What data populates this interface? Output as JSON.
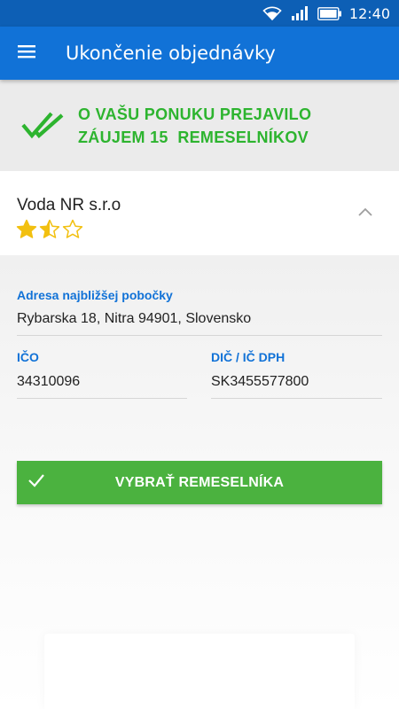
{
  "status_bar": {
    "time": "12:40",
    "icons": [
      "wifi-icon",
      "signal-icon",
      "battery-icon"
    ]
  },
  "app_bar": {
    "menu_icon": "hamburger-menu-icon",
    "title": "Ukončenie objednávky"
  },
  "banner": {
    "icon": "double-check-icon",
    "line1": "O VAŠU PONUKU PREJAVILO",
    "line2": "ZÁUJEM 15  REMESELNÍKOV"
  },
  "craftsman": {
    "name": "Voda NR s.r.o",
    "rating": 1.5,
    "rating_max": 3,
    "expand_icon": "chevron-up-icon"
  },
  "details": {
    "address_label": "Adresa najbližšej pobočky",
    "address_value": "Rybarska 18, Nitra 94901, Slovensko",
    "ico_label": "IČO",
    "ico_value": "34310096",
    "dic_label": "DIČ / IČ DPH",
    "dic_value": "SK3455577800"
  },
  "select_button": {
    "icon": "check-icon",
    "label": "VYBRAŤ REMESELNÍKA"
  },
  "colors": {
    "status_bar": "#0d5fb5",
    "app_bar": "#1172d7",
    "accent_blue": "#1172d7",
    "banner_green": "#2db42f",
    "button_green": "#4bb23f",
    "star_yellow": "#f2c010"
  }
}
